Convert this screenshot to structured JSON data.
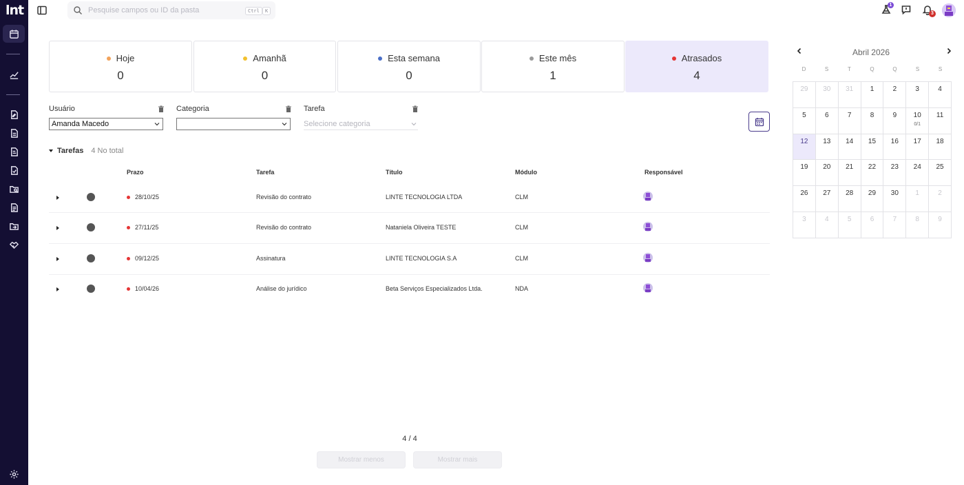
{
  "brand": {
    "logo_text": "lnt"
  },
  "search": {
    "placeholder": "Pesquise campos ou ID da pasta",
    "shortcut_key1": "Ctrl",
    "shortcut_key2": "K"
  },
  "notifications": {
    "tasks_badge": "1",
    "alerts_badge": "3"
  },
  "summary": [
    {
      "label": "Hoje",
      "count": "0",
      "color": "#f2a35c"
    },
    {
      "label": "Amanhã",
      "count": "0",
      "color": "#f2c12e"
    },
    {
      "label": "Esta semana",
      "count": "0",
      "color": "#4a6fc7"
    },
    {
      "label": "Este mês",
      "count": "1",
      "color": "#9a9a9a"
    },
    {
      "label": "Atrasados",
      "count": "4",
      "color": "#e53535"
    }
  ],
  "filters": {
    "user_label": "Usuário",
    "user_value": "Amanda Macedo",
    "category_label": "Categoria",
    "category_value": "",
    "task_label": "Tarefa",
    "task_placeholder": "Selecione categoria"
  },
  "tasks": {
    "section_title": "Tarefas",
    "total_text": "4 No total",
    "columns": [
      "Prazo",
      "Tarefa",
      "Título",
      "Módulo",
      "Responsável"
    ],
    "rows": [
      {
        "deadline": "28/10/25",
        "task": "Revisão do contrato",
        "title": "LINTE TECNOLOGIA LTDA",
        "module": "CLM"
      },
      {
        "deadline": "27/11/25",
        "task": "Revisão do contrato",
        "title": "Nataniela Oliveira TESTE",
        "module": "CLM"
      },
      {
        "deadline": "09/12/25",
        "task": "Assinatura",
        "title": "LINTE TECNOLOGIA S.A",
        "module": "CLM"
      },
      {
        "deadline": "10/04/26",
        "task": "Análise do jurídico",
        "title": "Beta Serviços Especializados Ltda.",
        "module": "NDA"
      }
    ]
  },
  "pagination": {
    "status": "4 / 4",
    "show_less": "Mostrar menos",
    "show_more": "Mostrar mais"
  },
  "calendar": {
    "month_title": "Abril 2026",
    "weekdays": [
      "D",
      "S",
      "T",
      "Q",
      "Q",
      "S",
      "S"
    ],
    "weeks": [
      [
        {
          "d": "29",
          "m": true
        },
        {
          "d": "30",
          "m": true
        },
        {
          "d": "31",
          "m": true
        },
        {
          "d": "1"
        },
        {
          "d": "2"
        },
        {
          "d": "3"
        },
        {
          "d": "4"
        }
      ],
      [
        {
          "d": "5"
        },
        {
          "d": "6"
        },
        {
          "d": "7"
        },
        {
          "d": "8"
        },
        {
          "d": "9"
        },
        {
          "d": "10",
          "sub": "0/1"
        },
        {
          "d": "11"
        }
      ],
      [
        {
          "d": "12",
          "today": true
        },
        {
          "d": "13"
        },
        {
          "d": "14"
        },
        {
          "d": "15"
        },
        {
          "d": "16"
        },
        {
          "d": "17"
        },
        {
          "d": "18"
        }
      ],
      [
        {
          "d": "19"
        },
        {
          "d": "20"
        },
        {
          "d": "21"
        },
        {
          "d": "22"
        },
        {
          "d": "23"
        },
        {
          "d": "24"
        },
        {
          "d": "25"
        }
      ],
      [
        {
          "d": "26"
        },
        {
          "d": "27"
        },
        {
          "d": "28"
        },
        {
          "d": "29"
        },
        {
          "d": "30"
        },
        {
          "d": "1",
          "m": true
        },
        {
          "d": "2",
          "m": true
        }
      ],
      [
        {
          "d": "3",
          "m": true
        },
        {
          "d": "4",
          "m": true
        },
        {
          "d": "5",
          "m": true
        },
        {
          "d": "6",
          "m": true
        },
        {
          "d": "7",
          "m": true
        },
        {
          "d": "8",
          "m": true
        },
        {
          "d": "9",
          "m": true
        }
      ]
    ]
  }
}
